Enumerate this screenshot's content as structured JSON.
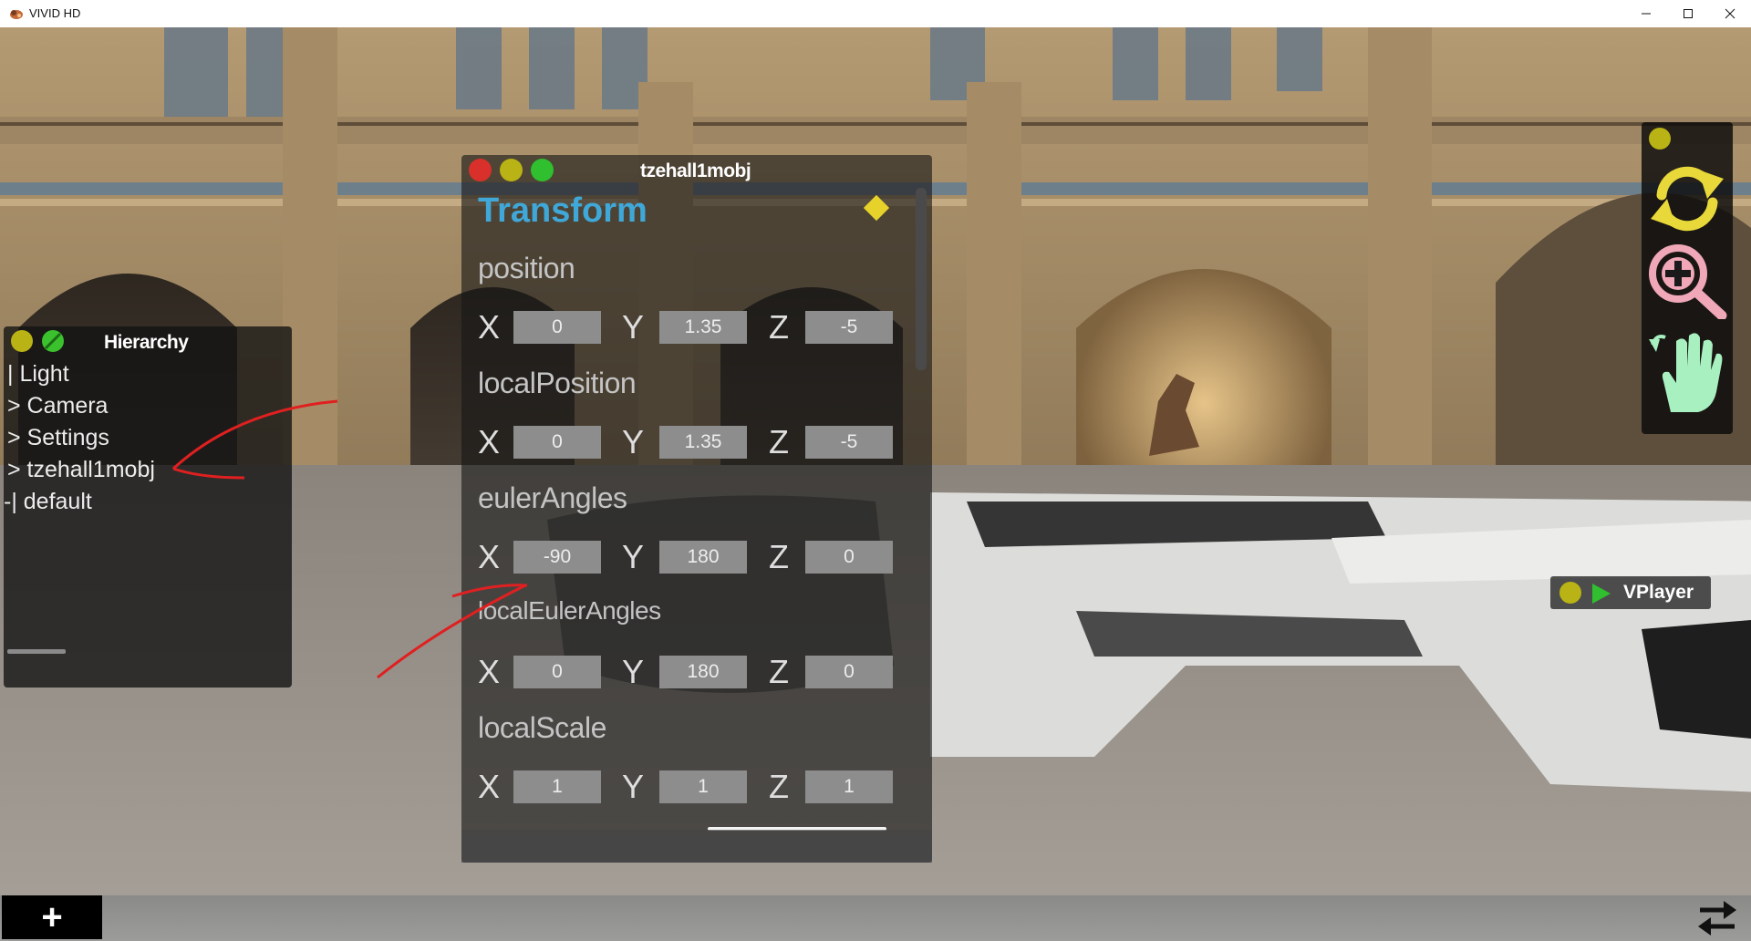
{
  "window": {
    "title": "VIVID HD",
    "icon": "app-icon",
    "controls": [
      "minimize-icon",
      "maximize-icon",
      "close-icon"
    ]
  },
  "hierarchy": {
    "title": "Hierarchy",
    "items": [
      {
        "label": "| Light"
      },
      {
        "label": "> Camera"
      },
      {
        "label": "> Settings"
      },
      {
        "label": "> tzehall1mobj"
      },
      {
        "label": "-| default"
      }
    ]
  },
  "inspector": {
    "title": "tzehall1mobj",
    "section": "Transform",
    "axis_labels": [
      "X",
      "Y",
      "Z"
    ],
    "properties": [
      {
        "label": "position",
        "values": [
          "0",
          "1.35",
          "-5"
        ]
      },
      {
        "label": "localPosition",
        "values": [
          "0",
          "1.35",
          "-5"
        ]
      },
      {
        "label": "eulerAngles",
        "values": [
          "-90",
          "180",
          "0"
        ]
      },
      {
        "label": "localEulerAngles",
        "values": [
          "0",
          "180",
          "0"
        ]
      },
      {
        "label": "localScale",
        "values": [
          "1",
          "1",
          "1"
        ]
      }
    ]
  },
  "tools": {
    "items": [
      "rotate-icon",
      "zoom-in-icon",
      "hand-pan-icon"
    ],
    "colors": {
      "rotate": "#e8d83a",
      "zoom": "#f0a8b8",
      "hand": "#a8f0c0"
    }
  },
  "vplayer": {
    "label": "VPlayer"
  },
  "bottom_bar": {
    "add_label": "+",
    "swap_icon": "swap-arrows-icon"
  },
  "colors": {
    "traffic_red": "#d9302b",
    "traffic_yellow": "#b9b315",
    "traffic_green": "#2fbf2f",
    "section_blue": "#3fa8d8",
    "annotation_red": "#e02020"
  }
}
